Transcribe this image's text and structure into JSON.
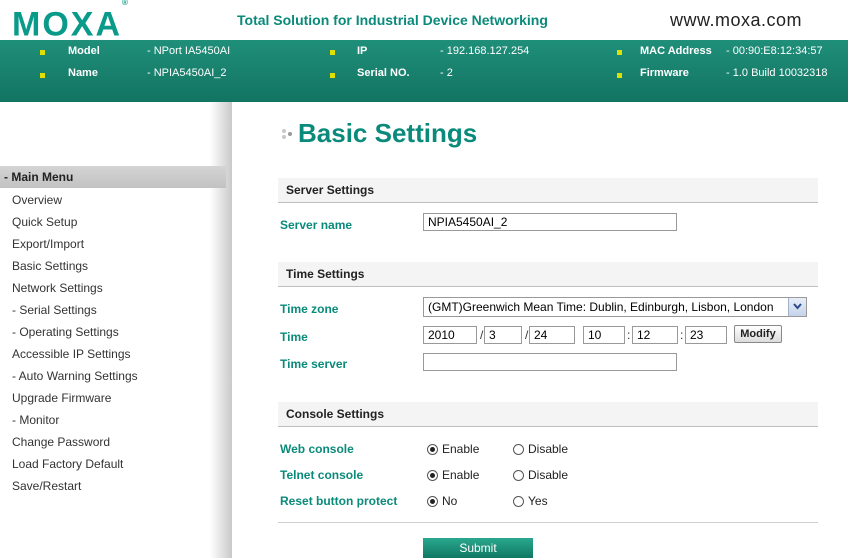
{
  "header": {
    "logo": "MOXA",
    "logo_mark": "®",
    "tagline": "Total Solution for Industrial Device Networking",
    "website": "www.moxa.com"
  },
  "device_info": {
    "model_label": "Model",
    "model_value": "- NPort IA5450AI",
    "name_label": "Name",
    "name_value": "- NPIA5450AI_2",
    "ip_label": "IP",
    "ip_value": "- 192.168.127.254",
    "serial_label": "Serial NO.",
    "serial_value": "- 2",
    "mac_label": "MAC Address",
    "mac_value": "- 00:90:E8:12:34:57",
    "firmware_label": "Firmware",
    "firmware_value": "- 1.0 Build 10032318"
  },
  "sidebar": {
    "head": "- Main Menu",
    "items": [
      "Overview",
      "Quick Setup",
      "Export/Import",
      "Basic Settings",
      "Network Settings",
      "- Serial Settings",
      "- Operating Settings",
      "Accessible IP Settings",
      "- Auto Warning Settings",
      "Upgrade Firmware",
      "- Monitor",
      "Change Password",
      "Load Factory Default",
      "Save/Restart"
    ]
  },
  "page": {
    "title": "Basic Settings"
  },
  "server_settings": {
    "heading": "Server Settings",
    "server_name_label": "Server name",
    "server_name_value": "NPIA5450AI_2"
  },
  "time_settings": {
    "heading": "Time Settings",
    "timezone_label": "Time zone",
    "timezone_value": "(GMT)Greenwich Mean Time: Dublin, Edinburgh, Lisbon, London",
    "time_label": "Time",
    "year": "2010",
    "month": "3",
    "day": "24",
    "hour": "10",
    "minute": "12",
    "second": "23",
    "date_sep": "/",
    "time_sep": ":",
    "modify_button": "Modify",
    "time_server_label": "Time server",
    "time_server_value": ""
  },
  "console_settings": {
    "heading": "Console Settings",
    "web_label": "Web console",
    "telnet_label": "Telnet console",
    "reset_label": "Reset button protect",
    "enable": "Enable",
    "disable": "Disable",
    "no": "No",
    "yes": "Yes",
    "web_selected": "Enable",
    "telnet_selected": "Enable",
    "reset_selected": "No"
  },
  "actions": {
    "submit": "Submit"
  },
  "colors": {
    "brand": "#0a8a7a",
    "info_bar": "#1f8f7a",
    "bullet": "#e0e000"
  }
}
